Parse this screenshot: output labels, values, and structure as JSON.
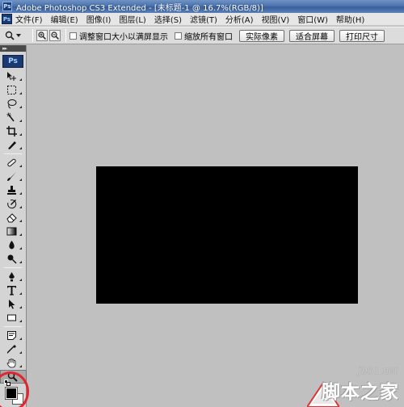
{
  "window": {
    "title": "Adobe Photoshop CS3 Extended - [未标题-1 @ 16.7%(RGB/8)]",
    "icon": "Ps"
  },
  "menubar": {
    "logo": "Ps",
    "items": [
      {
        "label": "文件(F)"
      },
      {
        "label": "编辑(E)"
      },
      {
        "label": "图像(I)"
      },
      {
        "label": "图层(L)"
      },
      {
        "label": "选择(S)"
      },
      {
        "label": "滤镜(T)"
      },
      {
        "label": "分析(A)"
      },
      {
        "label": "视图(V)"
      },
      {
        "label": "窗口(W)"
      },
      {
        "label": "帮助(H)"
      }
    ]
  },
  "options": {
    "checkbox_resize": "调整窗口大小以满屏显示",
    "checkbox_zoom_all": "缩放所有窗口",
    "btn_actual_pixels": "实际像素",
    "btn_fit_screen": "适合屏幕",
    "btn_print_size": "打印尺寸"
  },
  "toolbox": {
    "header": "Ps",
    "tools": [
      "move-tool-icon",
      "marquee-tool-icon",
      "lasso-tool-icon",
      "quick-selection-tool-icon",
      "crop-tool-icon",
      "slice-tool-icon",
      "healing-brush-tool-icon",
      "brush-tool-icon",
      "clone-stamp-tool-icon",
      "history-brush-tool-icon",
      "eraser-tool-icon",
      "gradient-tool-icon",
      "blur-tool-icon",
      "dodge-tool-icon",
      "pen-tool-icon",
      "type-tool-icon",
      "path-selection-tool-icon",
      "rectangle-tool-icon",
      "notes-tool-icon",
      "eyedropper-tool-icon",
      "hand-tool-icon",
      "zoom-tool-icon"
    ],
    "foreground_color": "#000000",
    "background_color": "#ffffff"
  },
  "document": {
    "canvas_color": "#000000",
    "workspace_color": "#c0c0c0"
  },
  "watermark": {
    "url": "jb51.net",
    "name": "脚本之家"
  },
  "colors": {
    "annotation_circle": "#e2252f",
    "title_bar": "#4d74ae"
  }
}
